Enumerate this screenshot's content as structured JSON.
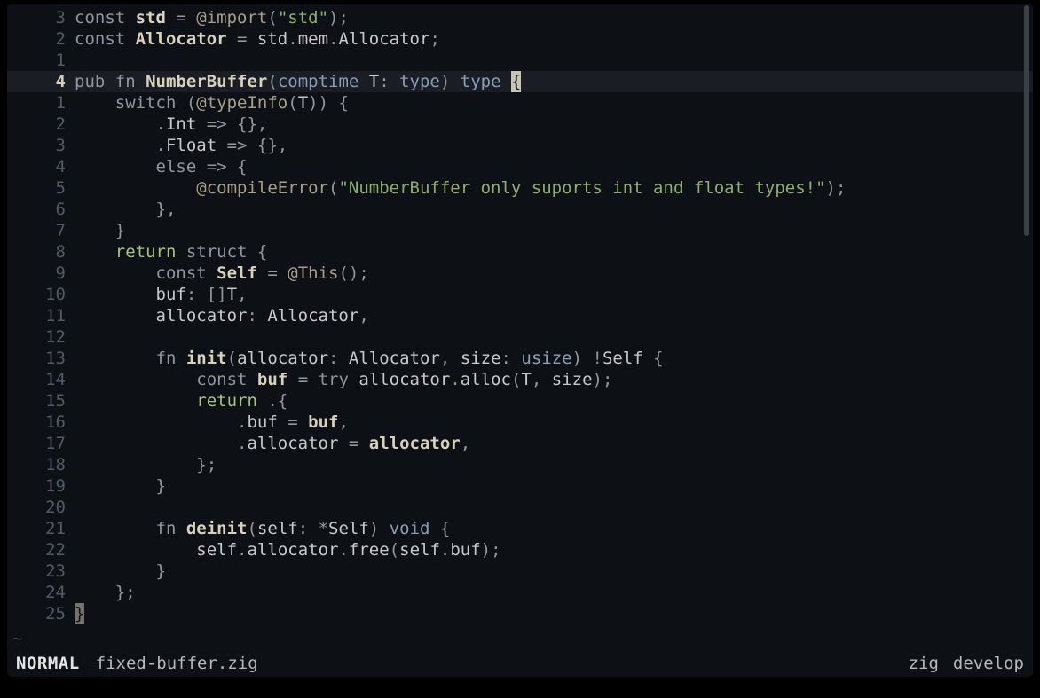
{
  "statusline": {
    "mode": "NORMAL",
    "filename": "fixed-buffer.zig",
    "filetype": "zig",
    "branch": "develop"
  },
  "current_line_abs": "4",
  "eob_marker": "~",
  "lines": [
    {
      "num": "3",
      "tokens": [
        [
          "kw",
          "const "
        ],
        [
          "id",
          "std"
        ],
        [
          "punc",
          " = "
        ],
        [
          "builtin",
          "@import"
        ],
        [
          "punc",
          "("
        ],
        [
          "str",
          "\"std\""
        ],
        [
          "punc",
          ");"
        ]
      ]
    },
    {
      "num": "2",
      "tokens": [
        [
          "kw",
          "const "
        ],
        [
          "id",
          "Allocator"
        ],
        [
          "punc",
          " = "
        ],
        [
          "idn",
          "std"
        ],
        [
          "punc",
          "."
        ],
        [
          "idn",
          "mem"
        ],
        [
          "punc",
          "."
        ],
        [
          "idn",
          "Allocator"
        ],
        [
          "punc",
          ";"
        ]
      ]
    },
    {
      "num": "1",
      "tokens": []
    },
    {
      "num": "4",
      "current": true,
      "tokens": [
        [
          "kw",
          "pub fn "
        ],
        [
          "fnname",
          "NumberBuffer"
        ],
        [
          "punc",
          "("
        ],
        [
          "type-k",
          "comptime "
        ],
        [
          "param",
          "T"
        ],
        [
          "punc",
          ": "
        ],
        [
          "type-k",
          "type"
        ],
        [
          "punc",
          ") "
        ],
        [
          "type-k",
          "type "
        ],
        [
          "cursor",
          "{"
        ]
      ]
    },
    {
      "num": "1",
      "tokens": [
        [
          "",
          "    "
        ],
        [
          "kw",
          "switch "
        ],
        [
          "punc",
          "("
        ],
        [
          "builtin",
          "@typeInfo"
        ],
        [
          "punc",
          "("
        ],
        [
          "idn",
          "T"
        ],
        [
          "punc",
          ")) {"
        ]
      ]
    },
    {
      "num": "2",
      "tokens": [
        [
          "",
          "        "
        ],
        [
          "punc",
          "."
        ],
        [
          "idn",
          "Int"
        ],
        [
          "punc",
          " => {},"
        ]
      ]
    },
    {
      "num": "3",
      "tokens": [
        [
          "",
          "        "
        ],
        [
          "punc",
          "."
        ],
        [
          "idn",
          "Float"
        ],
        [
          "punc",
          " => {},"
        ]
      ]
    },
    {
      "num": "4",
      "tokens": [
        [
          "",
          "        "
        ],
        [
          "kw",
          "else"
        ],
        [
          "punc",
          " => {"
        ]
      ]
    },
    {
      "num": "5",
      "tokens": [
        [
          "",
          "            "
        ],
        [
          "builtin",
          "@compileError"
        ],
        [
          "punc",
          "("
        ],
        [
          "str",
          "\"NumberBuffer only suports int and float types!\""
        ],
        [
          "punc",
          ");"
        ]
      ]
    },
    {
      "num": "6",
      "tokens": [
        [
          "",
          "        "
        ],
        [
          "punc",
          "},"
        ]
      ]
    },
    {
      "num": "7",
      "tokens": [
        [
          "",
          "    "
        ],
        [
          "punc",
          "}"
        ]
      ]
    },
    {
      "num": "8",
      "tokens": [
        [
          "",
          "    "
        ],
        [
          "ret",
          "return "
        ],
        [
          "kw",
          "struct "
        ],
        [
          "punc",
          "{"
        ]
      ]
    },
    {
      "num": "9",
      "tokens": [
        [
          "",
          "        "
        ],
        [
          "kw",
          "const "
        ],
        [
          "id",
          "Self"
        ],
        [
          "punc",
          " = "
        ],
        [
          "builtin",
          "@This"
        ],
        [
          "punc",
          "();"
        ]
      ]
    },
    {
      "num": "10",
      "tokens": [
        [
          "",
          "        "
        ],
        [
          "idn",
          "buf"
        ],
        [
          "punc",
          ": []"
        ],
        [
          "idn",
          "T"
        ],
        [
          "punc",
          ","
        ]
      ]
    },
    {
      "num": "11",
      "tokens": [
        [
          "",
          "        "
        ],
        [
          "idn",
          "allocator"
        ],
        [
          "punc",
          ": "
        ],
        [
          "idn",
          "Allocator"
        ],
        [
          "punc",
          ","
        ]
      ]
    },
    {
      "num": "12",
      "tokens": []
    },
    {
      "num": "13",
      "tokens": [
        [
          "",
          "        "
        ],
        [
          "kw",
          "fn "
        ],
        [
          "fnname",
          "init"
        ],
        [
          "punc",
          "("
        ],
        [
          "param",
          "allocator"
        ],
        [
          "punc",
          ": "
        ],
        [
          "idn",
          "Allocator"
        ],
        [
          "punc",
          ", "
        ],
        [
          "param",
          "size"
        ],
        [
          "punc",
          ": "
        ],
        [
          "type-k",
          "usize"
        ],
        [
          "punc",
          ") !"
        ],
        [
          "idn",
          "Self"
        ],
        [
          "punc",
          " {"
        ]
      ]
    },
    {
      "num": "14",
      "tokens": [
        [
          "",
          "            "
        ],
        [
          "kw",
          "const "
        ],
        [
          "id",
          "buf"
        ],
        [
          "punc",
          " = "
        ],
        [
          "kw",
          "try "
        ],
        [
          "idn",
          "allocator"
        ],
        [
          "punc",
          "."
        ],
        [
          "idn",
          "alloc"
        ],
        [
          "punc",
          "("
        ],
        [
          "idn",
          "T"
        ],
        [
          "punc",
          ", "
        ],
        [
          "idn",
          "size"
        ],
        [
          "punc",
          ");"
        ]
      ]
    },
    {
      "num": "15",
      "tokens": [
        [
          "",
          "            "
        ],
        [
          "ret",
          "return "
        ],
        [
          "punc",
          ".{"
        ]
      ]
    },
    {
      "num": "16",
      "tokens": [
        [
          "",
          "                "
        ],
        [
          "punc",
          "."
        ],
        [
          "idn",
          "buf"
        ],
        [
          "punc",
          " = "
        ],
        [
          "id",
          "buf"
        ],
        [
          "punc",
          ","
        ]
      ]
    },
    {
      "num": "17",
      "tokens": [
        [
          "",
          "                "
        ],
        [
          "punc",
          "."
        ],
        [
          "idn",
          "allocator"
        ],
        [
          "punc",
          " = "
        ],
        [
          "id",
          "allocator"
        ],
        [
          "punc",
          ","
        ]
      ]
    },
    {
      "num": "18",
      "tokens": [
        [
          "",
          "            "
        ],
        [
          "punc",
          "};"
        ]
      ]
    },
    {
      "num": "19",
      "tokens": [
        [
          "",
          "        "
        ],
        [
          "punc",
          "}"
        ]
      ]
    },
    {
      "num": "20",
      "tokens": []
    },
    {
      "num": "21",
      "tokens": [
        [
          "",
          "        "
        ],
        [
          "kw",
          "fn "
        ],
        [
          "fnname",
          "deinit"
        ],
        [
          "punc",
          "("
        ],
        [
          "param",
          "self"
        ],
        [
          "punc",
          ": *"
        ],
        [
          "idn",
          "Self"
        ],
        [
          "punc",
          ") "
        ],
        [
          "type-k",
          "void"
        ],
        [
          "punc",
          " {"
        ]
      ]
    },
    {
      "num": "22",
      "tokens": [
        [
          "",
          "            "
        ],
        [
          "idn",
          "self"
        ],
        [
          "punc",
          "."
        ],
        [
          "idn",
          "allocator"
        ],
        [
          "punc",
          "."
        ],
        [
          "idn",
          "free"
        ],
        [
          "punc",
          "("
        ],
        [
          "idn",
          "self"
        ],
        [
          "punc",
          "."
        ],
        [
          "idn",
          "buf"
        ],
        [
          "punc",
          ");"
        ]
      ]
    },
    {
      "num": "23",
      "tokens": [
        [
          "",
          "        "
        ],
        [
          "punc",
          "}"
        ]
      ]
    },
    {
      "num": "24",
      "tokens": [
        [
          "",
          "    "
        ],
        [
          "punc",
          "};"
        ]
      ]
    },
    {
      "num": "25",
      "tokens": [
        [
          "cursor-dim",
          "}"
        ]
      ]
    }
  ]
}
